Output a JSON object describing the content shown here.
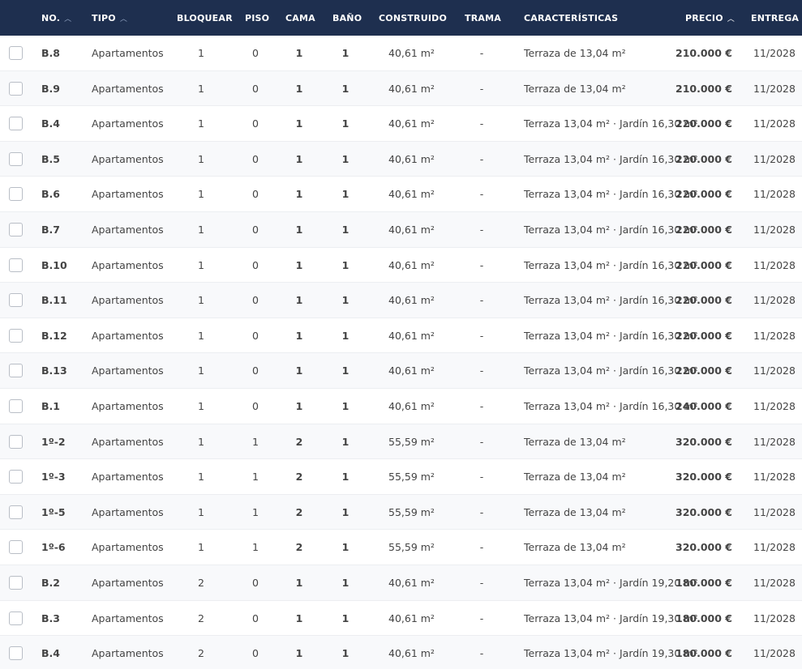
{
  "headers": {
    "no": "NO.",
    "tipo": "TIPO",
    "bloquear": "BLOQUEAR",
    "piso": "PISO",
    "cama": "CAMA",
    "bano": "BAÑO",
    "construido": "CONSTRUIDO",
    "trama": "TRAMA",
    "caracteristicas": "CARACTERÍSTICAS",
    "precio": "PRECIO",
    "entrega": "ENTREGA"
  },
  "rows": [
    {
      "no": "B.8",
      "tipo": "Apartamentos",
      "bloquear": "1",
      "piso": "0",
      "cama": "1",
      "bano": "1",
      "construido": "40,61 m²",
      "trama": "-",
      "caracteristicas": "Terraza de 13,04 m²",
      "precio": "210.000 €",
      "entrega": "11/2028"
    },
    {
      "no": "B.9",
      "tipo": "Apartamentos",
      "bloquear": "1",
      "piso": "0",
      "cama": "1",
      "bano": "1",
      "construido": "40,61 m²",
      "trama": "-",
      "caracteristicas": "Terraza de 13,04 m²",
      "precio": "210.000 €",
      "entrega": "11/2028"
    },
    {
      "no": "B.4",
      "tipo": "Apartamentos",
      "bloquear": "1",
      "piso": "0",
      "cama": "1",
      "bano": "1",
      "construido": "40,61 m²",
      "trama": "-",
      "caracteristicas": "Terraza 13,04 m² · Jardín 16,30 m²",
      "precio": "220.000 €",
      "entrega": "11/2028"
    },
    {
      "no": "B.5",
      "tipo": "Apartamentos",
      "bloquear": "1",
      "piso": "0",
      "cama": "1",
      "bano": "1",
      "construido": "40,61 m²",
      "trama": "-",
      "caracteristicas": "Terraza 13,04 m² · Jardín 16,30 m²",
      "precio": "220.000 €",
      "entrega": "11/2028"
    },
    {
      "no": "B.6",
      "tipo": "Apartamentos",
      "bloquear": "1",
      "piso": "0",
      "cama": "1",
      "bano": "1",
      "construido": "40,61 m²",
      "trama": "-",
      "caracteristicas": "Terraza 13,04 m² · Jardín 16,30 m²",
      "precio": "220.000 €",
      "entrega": "11/2028"
    },
    {
      "no": "B.7",
      "tipo": "Apartamentos",
      "bloquear": "1",
      "piso": "0",
      "cama": "1",
      "bano": "1",
      "construido": "40,61 m²",
      "trama": "-",
      "caracteristicas": "Terraza 13,04 m² · Jardín 16,30 m²",
      "precio": "220.000 €",
      "entrega": "11/2028"
    },
    {
      "no": "B.10",
      "tipo": "Apartamentos",
      "bloquear": "1",
      "piso": "0",
      "cama": "1",
      "bano": "1",
      "construido": "40,61 m²",
      "trama": "-",
      "caracteristicas": "Terraza 13,04 m² · Jardín 16,30 m²",
      "precio": "220.000 €",
      "entrega": "11/2028"
    },
    {
      "no": "B.11",
      "tipo": "Apartamentos",
      "bloquear": "1",
      "piso": "0",
      "cama": "1",
      "bano": "1",
      "construido": "40,61 m²",
      "trama": "-",
      "caracteristicas": "Terraza 13,04 m² · Jardín 16,30 m²",
      "precio": "220.000 €",
      "entrega": "11/2028"
    },
    {
      "no": "B.12",
      "tipo": "Apartamentos",
      "bloquear": "1",
      "piso": "0",
      "cama": "1",
      "bano": "1",
      "construido": "40,61 m²",
      "trama": "-",
      "caracteristicas": "Terraza 13,04 m² · Jardín 16,30 m²",
      "precio": "220.000 €",
      "entrega": "11/2028"
    },
    {
      "no": "B.13",
      "tipo": "Apartamentos",
      "bloquear": "1",
      "piso": "0",
      "cama": "1",
      "bano": "1",
      "construido": "40,61 m²",
      "trama": "-",
      "caracteristicas": "Terraza 13,04 m² · Jardín 16,30 m²",
      "precio": "220.000 €",
      "entrega": "11/2028"
    },
    {
      "no": "B.1",
      "tipo": "Apartamentos",
      "bloquear": "1",
      "piso": "0",
      "cama": "1",
      "bano": "1",
      "construido": "40,61 m²",
      "trama": "-",
      "caracteristicas": "Terraza 13,04 m² · Jardín 16,30 m²",
      "precio": "240.000 €",
      "entrega": "11/2028"
    },
    {
      "no": "1º-2",
      "tipo": "Apartamentos",
      "bloquear": "1",
      "piso": "1",
      "cama": "2",
      "bano": "1",
      "construido": "55,59 m²",
      "trama": "-",
      "caracteristicas": "Terraza de 13,04 m²",
      "precio": "320.000 €",
      "entrega": "11/2028"
    },
    {
      "no": "1º-3",
      "tipo": "Apartamentos",
      "bloquear": "1",
      "piso": "1",
      "cama": "2",
      "bano": "1",
      "construido": "55,59 m²",
      "trama": "-",
      "caracteristicas": "Terraza de 13,04 m²",
      "precio": "320.000 €",
      "entrega": "11/2028"
    },
    {
      "no": "1º-5",
      "tipo": "Apartamentos",
      "bloquear": "1",
      "piso": "1",
      "cama": "2",
      "bano": "1",
      "construido": "55,59 m²",
      "trama": "-",
      "caracteristicas": "Terraza de 13,04 m²",
      "precio": "320.000 €",
      "entrega": "11/2028"
    },
    {
      "no": "1º-6",
      "tipo": "Apartamentos",
      "bloquear": "1",
      "piso": "1",
      "cama": "2",
      "bano": "1",
      "construido": "55,59 m²",
      "trama": "-",
      "caracteristicas": "Terraza de 13,04 m²",
      "precio": "320.000 €",
      "entrega": "11/2028"
    },
    {
      "no": "B.2",
      "tipo": "Apartamentos",
      "bloquear": "2",
      "piso": "0",
      "cama": "1",
      "bano": "1",
      "construido": "40,61 m²",
      "trama": "-",
      "caracteristicas": "Terraza 13,04 m² · Jardín 19,20 m²",
      "precio": "180.000 €",
      "entrega": "11/2028"
    },
    {
      "no": "B.3",
      "tipo": "Apartamentos",
      "bloquear": "2",
      "piso": "0",
      "cama": "1",
      "bano": "1",
      "construido": "40,61 m²",
      "trama": "-",
      "caracteristicas": "Terraza 13,04 m² · Jardín 19,30 m²",
      "precio": "180.000 €",
      "entrega": "11/2028"
    },
    {
      "no": "B.4",
      "tipo": "Apartamentos",
      "bloquear": "2",
      "piso": "0",
      "cama": "1",
      "bano": "1",
      "construido": "40,61 m²",
      "trama": "-",
      "caracteristicas": "Terraza 13,04 m² · Jardín 19,30 m²",
      "precio": "180.000 €",
      "entrega": "11/2028"
    }
  ]
}
